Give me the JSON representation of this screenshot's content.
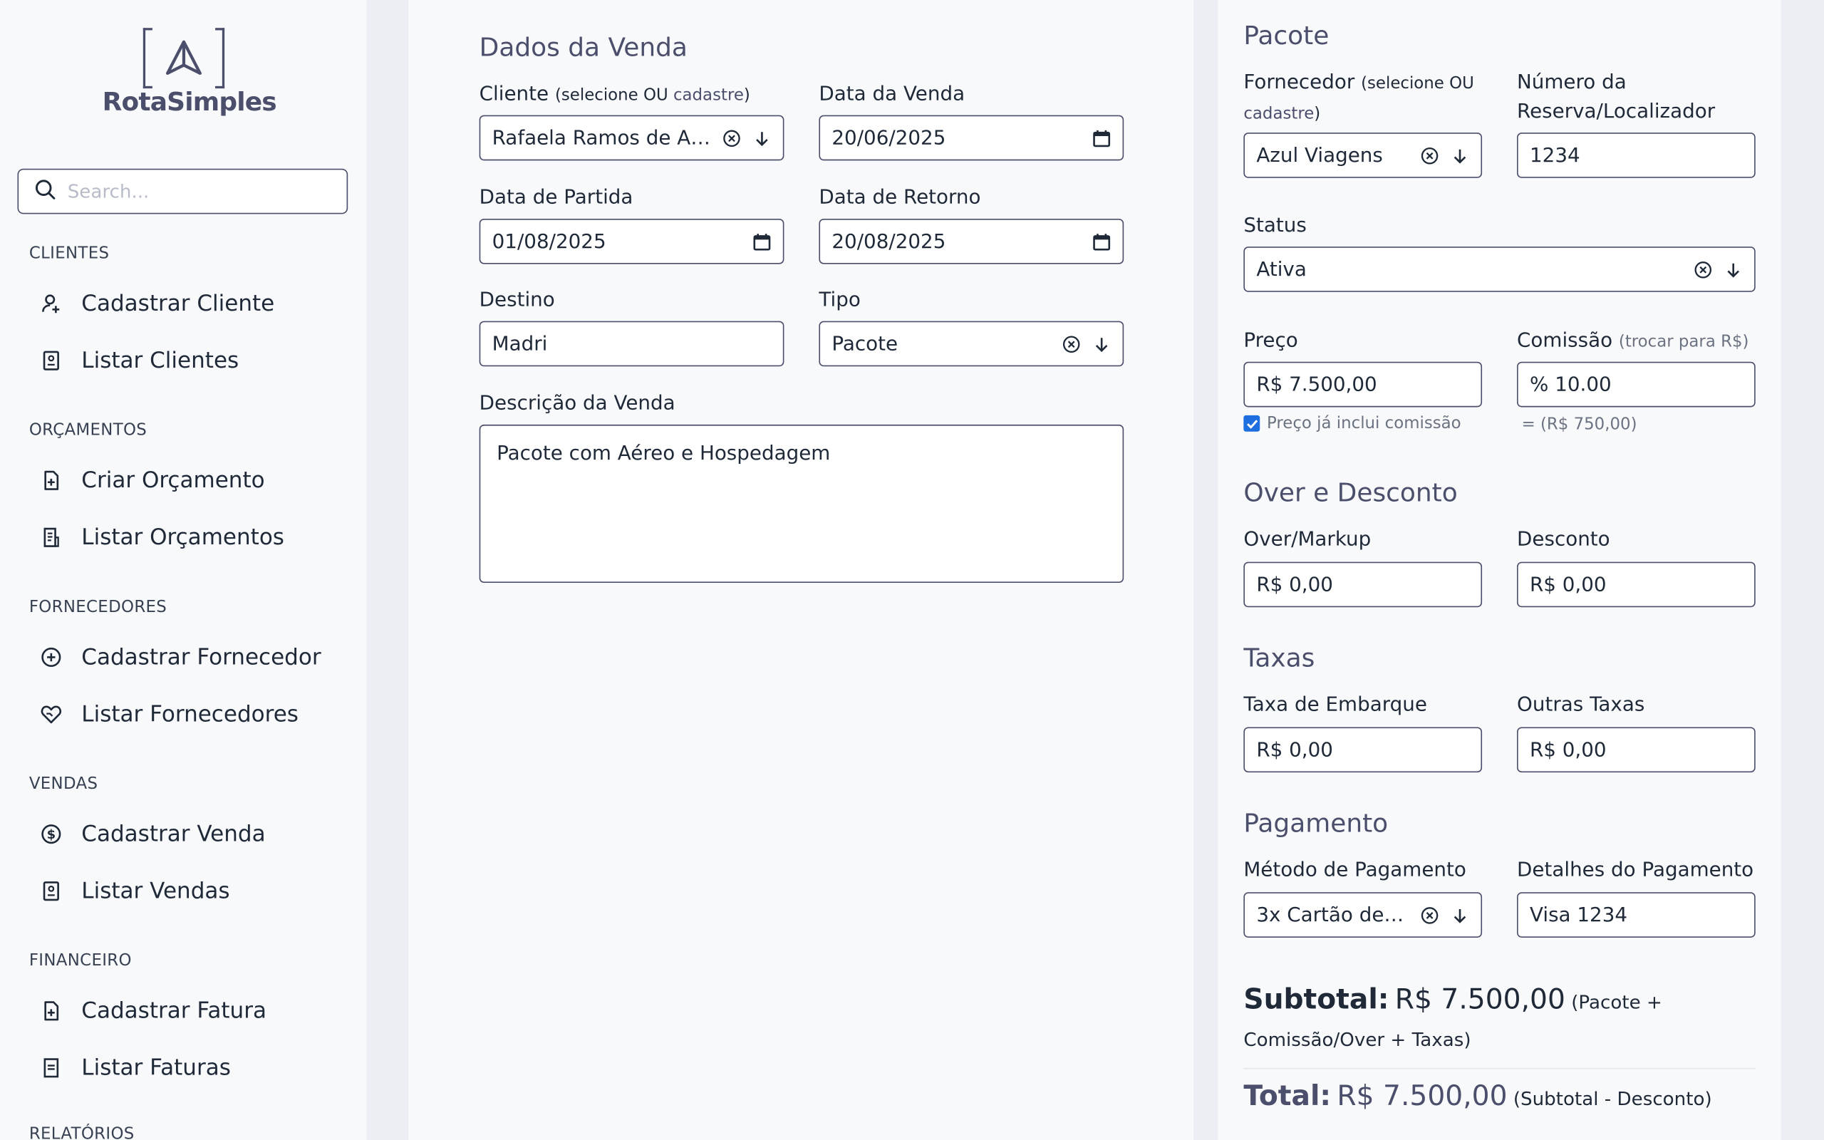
{
  "brand": {
    "name": "RotaSimples"
  },
  "search": {
    "placeholder": "Search..."
  },
  "sidebar": {
    "sections": [
      {
        "title": "CLIENTES",
        "items": [
          {
            "label": "Cadastrar Cliente",
            "icon": "user-add-icon"
          },
          {
            "label": "Listar Clientes",
            "icon": "contact-list-icon"
          }
        ]
      },
      {
        "title": "ORÇAMENTOS",
        "items": [
          {
            "label": "Criar Orçamento",
            "icon": "file-add-icon"
          },
          {
            "label": "Listar Orçamentos",
            "icon": "file-list-icon"
          }
        ]
      },
      {
        "title": "FORNECEDORES",
        "items": [
          {
            "label": "Cadastrar Fornecedor",
            "icon": "circle-plus-icon"
          },
          {
            "label": "Listar Fornecedores",
            "icon": "handshake-heart-icon"
          }
        ]
      },
      {
        "title": "VENDAS",
        "items": [
          {
            "label": "Cadastrar Venda",
            "icon": "dollar-circle-icon"
          },
          {
            "label": "Listar Vendas",
            "icon": "contact-list-icon"
          }
        ]
      },
      {
        "title": "FINANCEIRO",
        "items": [
          {
            "label": "Cadastrar Fatura",
            "icon": "file-add-icon"
          },
          {
            "label": "Listar Faturas",
            "icon": "document-icon"
          }
        ]
      }
    ],
    "last_section": "RELATÓRIOS"
  },
  "sale": {
    "title": "Dados da Venda",
    "cliente_label": "Cliente",
    "cliente_hint_pre": "(selecione OU ",
    "cliente_hint_link": "cadastre",
    "cliente_hint_post": ")",
    "cliente_value": "Rafaela Ramos de An...",
    "data_venda_label": "Data da Venda",
    "data_venda_value": "20/06/2025",
    "data_partida_label": "Data de Partida",
    "data_partida_value": "01/08/2025",
    "data_retorno_label": "Data de Retorno",
    "data_retorno_value": "20/08/2025",
    "destino_label": "Destino",
    "destino_value": "Madri",
    "tipo_label": "Tipo",
    "tipo_value": "Pacote",
    "descricao_label": "Descrição da Venda",
    "descricao_value": "Pacote com Aéreo e Hospedagem"
  },
  "package": {
    "title": "Pacote",
    "fornecedor_label": "Fornecedor",
    "fornecedor_hint_pre": "(selecione OU",
    "fornecedor_hint_link": "cadastre",
    "fornecedor_hint_post": ")",
    "fornecedor_value": "Azul Viagens",
    "reserva_label_1": "Número da",
    "reserva_label_2": "Reserva/Localizador",
    "reserva_value": "1234",
    "status_label": "Status",
    "status_value": "Ativa",
    "preco_label": "Preço",
    "preco_value": "R$ 7.500,00",
    "preco_checkbox_label": "Preço já inclui comissão",
    "preco_checkbox_checked": true,
    "comissao_label": "Comissão",
    "comissao_hint": "(trocar para R$)",
    "comissao_value": "% 10.00",
    "comissao_calc": "= (R$ 750,00)"
  },
  "over": {
    "title": "Over e Desconto",
    "over_label": "Over/Markup",
    "over_value": "R$ 0,00",
    "desconto_label": "Desconto",
    "desconto_value": "R$ 0,00"
  },
  "taxas": {
    "title": "Taxas",
    "embarque_label": "Taxa de Embarque",
    "embarque_value": "R$ 0,00",
    "outras_label": "Outras Taxas",
    "outras_value": "R$ 0,00"
  },
  "pagamento": {
    "title": "Pagamento",
    "metodo_label": "Método de Pagamento",
    "metodo_value": "3x Cartão de C...",
    "detalhes_label": "Detalhes do Pagamento",
    "detalhes_value": "Visa 1234"
  },
  "summary": {
    "subtotal_label": "Subtotal:",
    "subtotal_value": "R$ 7.500,00",
    "subtotal_note_1": "(Pacote +",
    "subtotal_note_2": "Comissão/Over + Taxas)",
    "total_label": "Total:",
    "total_value": "R$ 7.500,00",
    "total_note": "(Subtotal - Desconto)"
  },
  "colors": {
    "accent": "#4b4f6b",
    "checkbox": "#1d6fe0",
    "background": "#eceef3",
    "panel": "#f8f9fb"
  }
}
